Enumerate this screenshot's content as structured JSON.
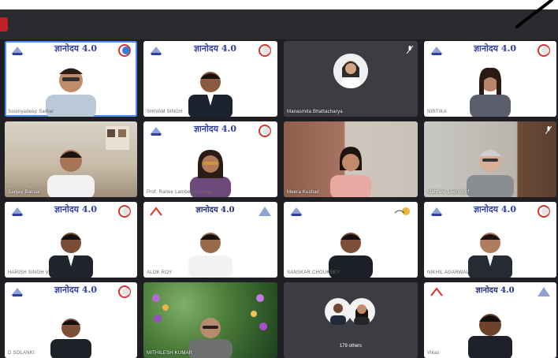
{
  "app": {
    "recording_color": "#c0202a",
    "accent_speaking": "#4f8df7"
  },
  "slide": {
    "title": "ज्ञानोदय 4.0",
    "title_alt": "ज्ञानोदय 4.0"
  },
  "tiles": [
    {
      "name": "Soumyadeep Sarkar",
      "type": "slide",
      "speaking": true
    },
    {
      "name": "SHIVAM SINGH",
      "type": "slide"
    },
    {
      "name": "Manasmita Bhattacharya",
      "type": "avatar"
    },
    {
      "name": "NIRTIKA",
      "type": "slide"
    },
    {
      "name": "Sanjay Bansal",
      "type": "room"
    },
    {
      "name": "Prof. Ranee Lamberta Kamal",
      "type": "slide"
    },
    {
      "name": "Meera Kushari",
      "type": "room2"
    },
    {
      "name": "Matthew Leerndorf",
      "type": "room3"
    },
    {
      "name": "HARISH SINGH V",
      "type": "slide"
    },
    {
      "name": "ALOK ROY",
      "type": "slide2"
    },
    {
      "name": "SANSKAR CHOUKSEY",
      "type": "slide3"
    },
    {
      "name": "NIKHIL AGARWAL",
      "type": "slide"
    },
    {
      "name": "D SOLANKI",
      "type": "slide"
    },
    {
      "name": "MITHILESH KUMAR",
      "type": "garden"
    },
    {
      "name": "179 others",
      "type": "others"
    },
    {
      "name": "Vikas",
      "type": "slide2"
    }
  ]
}
